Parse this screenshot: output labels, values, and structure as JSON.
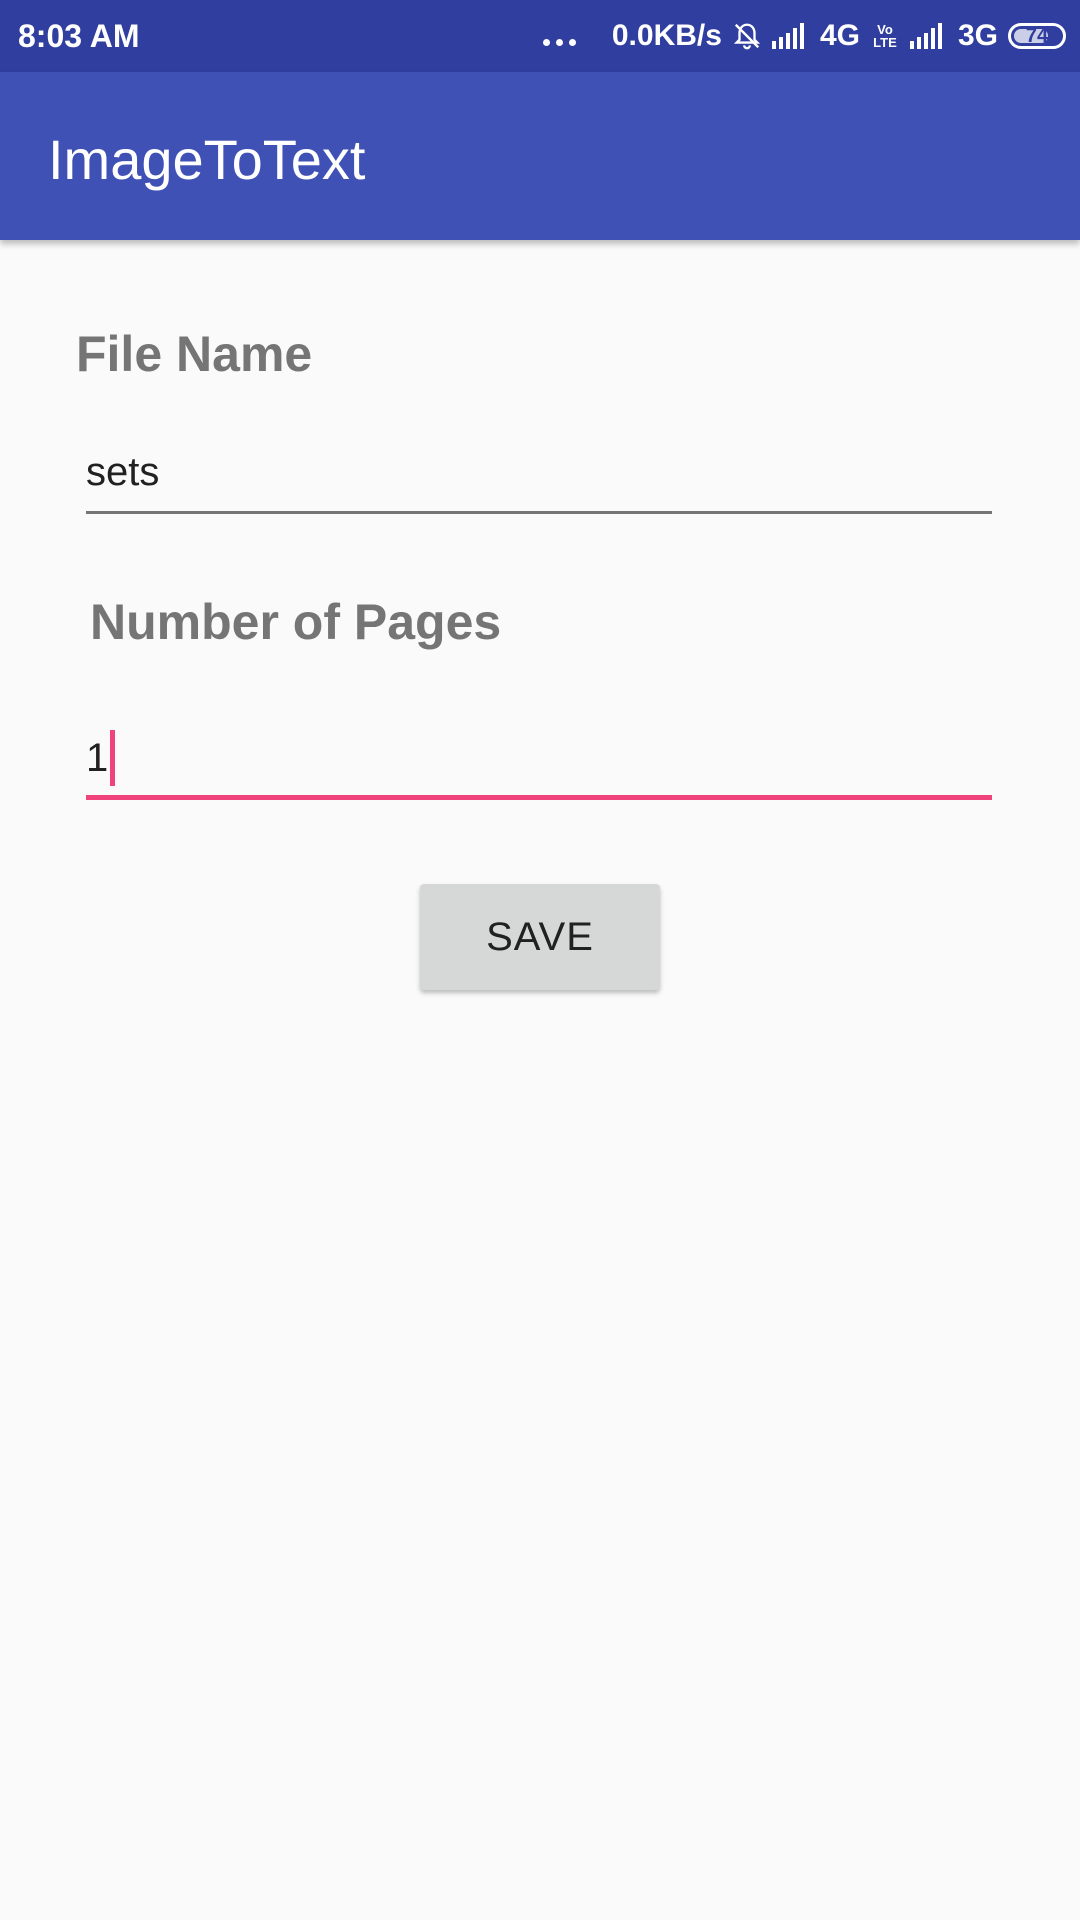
{
  "status_bar": {
    "time": "8:03 AM",
    "network_speed": "0.0KB/s",
    "network_1": "4G",
    "volte_top": "Vo",
    "volte_bottom": "LTE",
    "network_2": "3G",
    "battery": "74",
    "battery_level": 0.74
  },
  "app_bar": {
    "title": "ImageToText"
  },
  "form": {
    "file_name_label": "File Name",
    "file_name_value": "sets",
    "pages_label": "Number of Pages",
    "pages_value": "1",
    "save_label": "SAVE"
  },
  "colors": {
    "status_bar": "#303f9f",
    "app_bar": "#3f51b5",
    "accent": "#f0437c",
    "label": "#757575",
    "button": "#d6d7d7"
  }
}
